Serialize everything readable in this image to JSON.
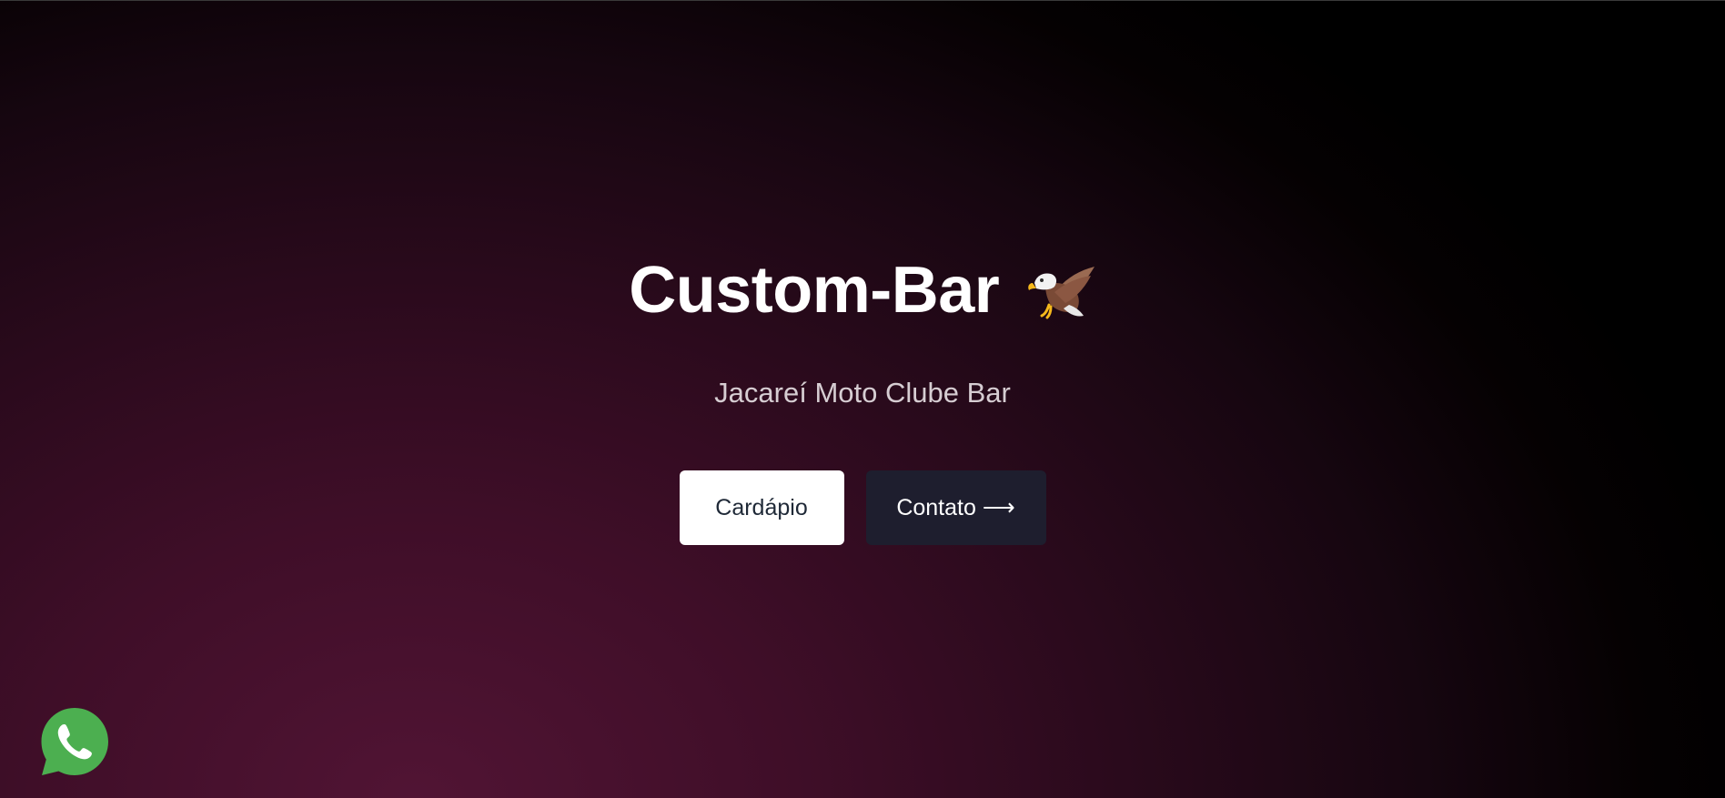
{
  "hero": {
    "title": "Custom-Bar",
    "title_icon": "eagle-icon",
    "subtitle": "Jacareí Moto Clube Bar"
  },
  "buttons": {
    "menu_label": "Cardápio",
    "contact_label": "Contato ⟶"
  },
  "floating": {
    "whatsapp_icon": "whatsapp-icon"
  },
  "colors": {
    "background_accent": "#511434",
    "primary_button_bg": "#ffffff",
    "secondary_button_bg": "#1e1e2e",
    "whatsapp_green": "#4caf50"
  }
}
